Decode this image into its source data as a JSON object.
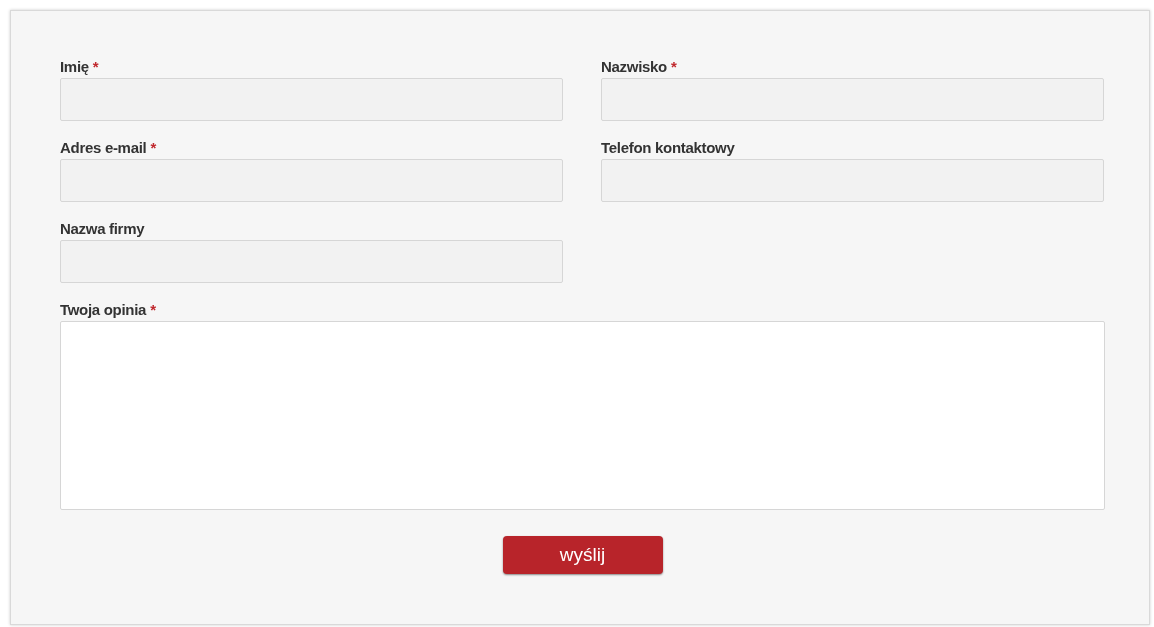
{
  "form_rows": [
    [
      {
        "label": "Imię",
        "marker": "*",
        "kind": "input"
      },
      {
        "label": "Nazwisko",
        "marker": "*",
        "kind": "input"
      }
    ],
    [
      {
        "label": "Adres e-mail",
        "marker": "*",
        "kind": "input"
      },
      {
        "label": "Telefon kontaktowy",
        "kind": "input"
      }
    ],
    [
      {
        "label": "Nazwa firmy",
        "kind": "input"
      }
    ],
    [
      {
        "label": "Twoja opinia",
        "marker": "*",
        "kind": "textarea"
      }
    ]
  ],
  "submit_button": {
    "label": "wyślij"
  }
}
